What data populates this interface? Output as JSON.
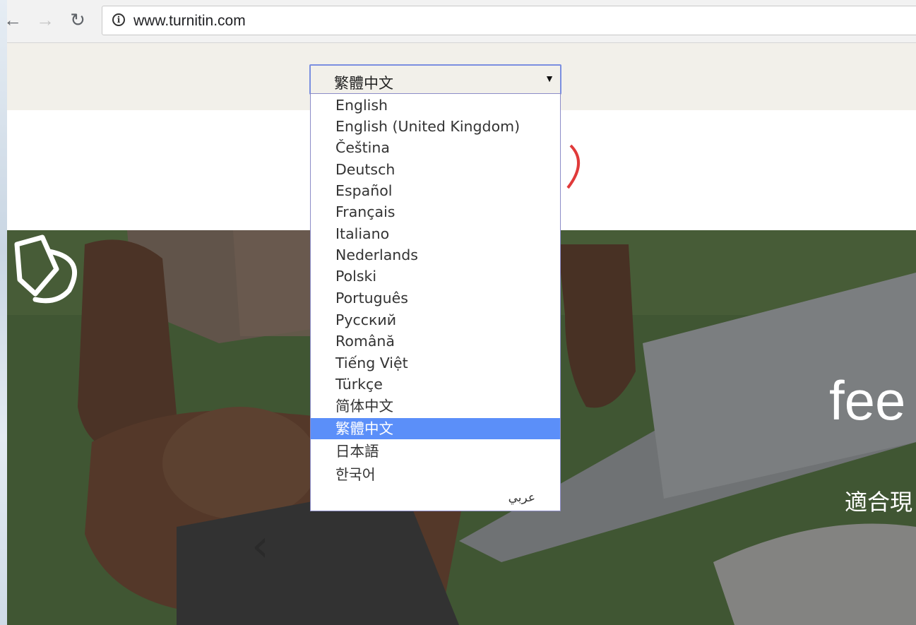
{
  "browser": {
    "url": "www.turnitin.com",
    "icons": {
      "back": "back-arrow-icon",
      "forward": "forward-arrow-icon",
      "reload": "reload-icon",
      "info": "info-icon"
    }
  },
  "language_select": {
    "selected_value": "繁體中文",
    "options": [
      "English",
      "English (United Kingdom)",
      "Čeština",
      "Deutsch",
      "Español",
      "Français",
      "Italiano",
      "Nederlands",
      "Polski",
      "Português",
      "Русский",
      "Română",
      "Tiếng Việt",
      "Türkçe",
      "简体中文",
      "繁體中文",
      "日本語",
      "한국어",
      "عربي"
    ],
    "highlighted_index": 15
  },
  "hero": {
    "brand_text": "fee",
    "tagline": "適合現",
    "prev_glyph": "‹"
  },
  "colors": {
    "selection": "#5b8ff9",
    "select_border": "#7b8fe0",
    "logo_red": "#e03a3a"
  }
}
